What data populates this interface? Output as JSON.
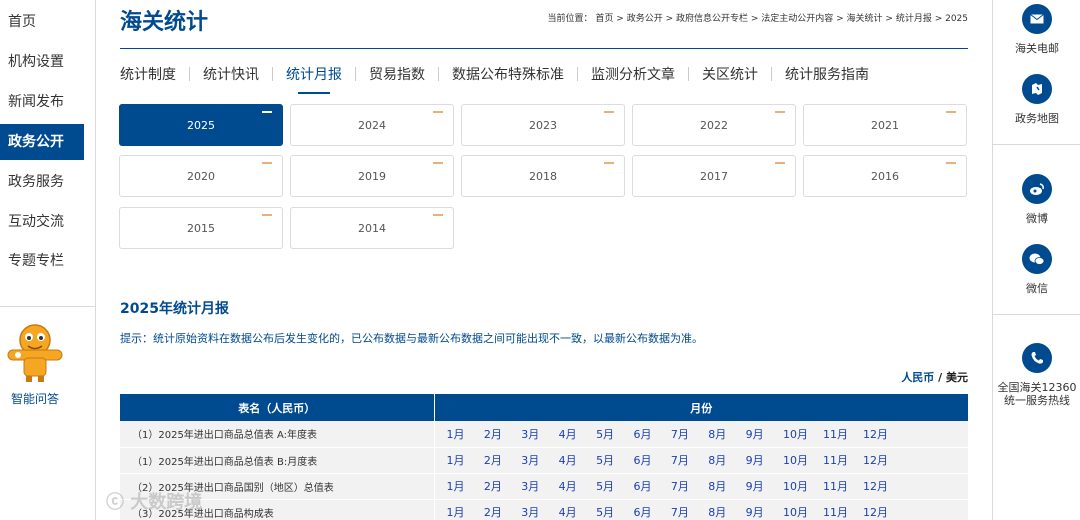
{
  "left_nav": {
    "items": [
      {
        "label": "首页",
        "active": false
      },
      {
        "label": "机构设置",
        "active": false
      },
      {
        "label": "新闻发布",
        "active": false
      },
      {
        "label": "政务公开",
        "active": true
      },
      {
        "label": "政务服务",
        "active": false
      },
      {
        "label": "互动交流",
        "active": false
      },
      {
        "label": "专题专栏",
        "active": false
      }
    ],
    "qa_label": "智能问答"
  },
  "header": {
    "title": "海关统计",
    "breadcrumb": [
      "当前位置：",
      "首页",
      "政务公开",
      "政府信息公开专栏",
      "法定主动公开内容",
      "海关统计",
      "统计月报",
      "2025"
    ]
  },
  "tabs": [
    {
      "label": "统计制度",
      "active": false
    },
    {
      "label": "统计快讯",
      "active": false
    },
    {
      "label": "统计月报",
      "active": true
    },
    {
      "label": "贸易指数",
      "active": false
    },
    {
      "label": "数据公布特殊标准",
      "active": false
    },
    {
      "label": "监测分析文章",
      "active": false
    },
    {
      "label": "关区统计",
      "active": false
    },
    {
      "label": "统计服务指南",
      "active": false
    }
  ],
  "years": [
    {
      "label": "2025",
      "active": true
    },
    {
      "label": "2024",
      "active": false
    },
    {
      "label": "2023",
      "active": false
    },
    {
      "label": "2022",
      "active": false
    },
    {
      "label": "2021",
      "active": false
    },
    {
      "label": "2020",
      "active": false
    },
    {
      "label": "2019",
      "active": false
    },
    {
      "label": "2018",
      "active": false
    },
    {
      "label": "2017",
      "active": false
    },
    {
      "label": "2016",
      "active": false
    },
    {
      "label": "2015",
      "active": false
    },
    {
      "label": "2014",
      "active": false
    }
  ],
  "section": {
    "title": "2025年统计月报",
    "hint": "提示：统计原始资料在数据公布后发生变化的，已公布数据与最新公布数据之间可能出现不一致，以最新公布数据为准。",
    "currency_rmb": "人民币",
    "currency_sep": " / ",
    "currency_usd": "美元"
  },
  "table": {
    "headers": {
      "name": "表名（人民币）",
      "month": "月份"
    },
    "months": [
      "1月",
      "2月",
      "3月",
      "4月",
      "5月",
      "6月",
      "7月",
      "8月",
      "9月",
      "10月",
      "11月",
      "12月"
    ],
    "rows": [
      "（1）2025年进出口商品总值表 A:年度表",
      "（1）2025年进出口商品总值表 B:月度表",
      "（2）2025年进出口商品国别（地区）总值表",
      "（3）2025年进出口商品构成表"
    ]
  },
  "right_panel": [
    {
      "label": "海关电邮",
      "icon": "mail-icon"
    },
    {
      "label": "政务地图",
      "icon": "map-icon"
    },
    {
      "label": "微博",
      "icon": "weibo-icon"
    },
    {
      "label": "微信",
      "icon": "wechat-icon"
    },
    {
      "label": "全国海关12360\n统一服务热线",
      "icon": "phone-icon"
    }
  ],
  "watermark": "大数跨境",
  "colors": {
    "brand": "#004a8f",
    "accent_dash": "#e8b07a",
    "month_link": "#1a3fb0"
  }
}
